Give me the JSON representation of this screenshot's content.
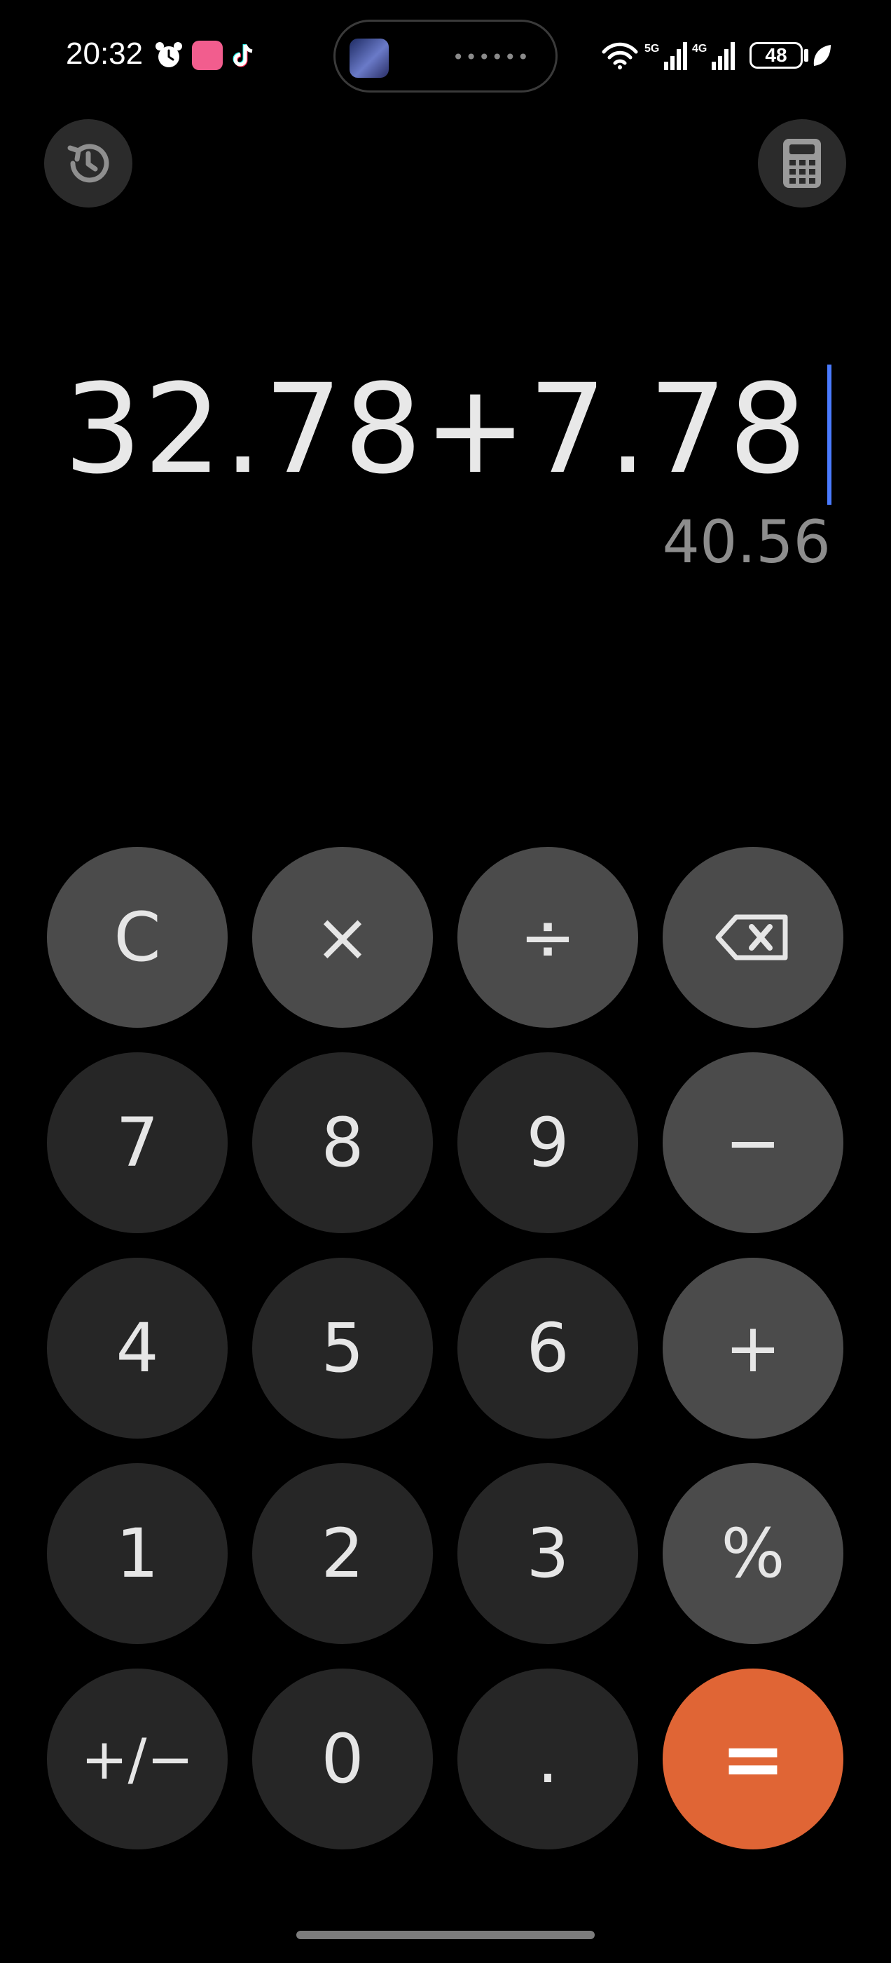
{
  "status_bar": {
    "time": "20:32",
    "battery": "48",
    "network_5g": "5G",
    "network_4g": "4G",
    "icons": [
      "alarm-icon",
      "bilibili-app-icon",
      "tiktok-icon",
      "wifi-icon",
      "signal-5g-icon",
      "signal-4g-icon",
      "battery-icon",
      "leaf-icon"
    ]
  },
  "island": {
    "dots": "••••••"
  },
  "toolbar": {
    "history_icon": "clock-history-icon",
    "mode_icon": "calculator-icon"
  },
  "display": {
    "expression": "32.78+7.78",
    "result": "40.56"
  },
  "keypad": {
    "clear": "C",
    "multiply": "×",
    "divide": "÷",
    "backspace_icon": "backspace-icon",
    "seven": "7",
    "eight": "8",
    "nine": "9",
    "minus": "−",
    "four": "4",
    "five": "5",
    "six": "6",
    "plus": "+",
    "one": "1",
    "two": "2",
    "three": "3",
    "percent": "%",
    "sign": "+/−",
    "zero": "0",
    "decimal": ".",
    "equals": "="
  },
  "colors": {
    "background": "#000000",
    "number_key": "#262626",
    "operator_key": "#4b4b4b",
    "equals_key": "#e06535",
    "cursor": "#4a7bff"
  }
}
